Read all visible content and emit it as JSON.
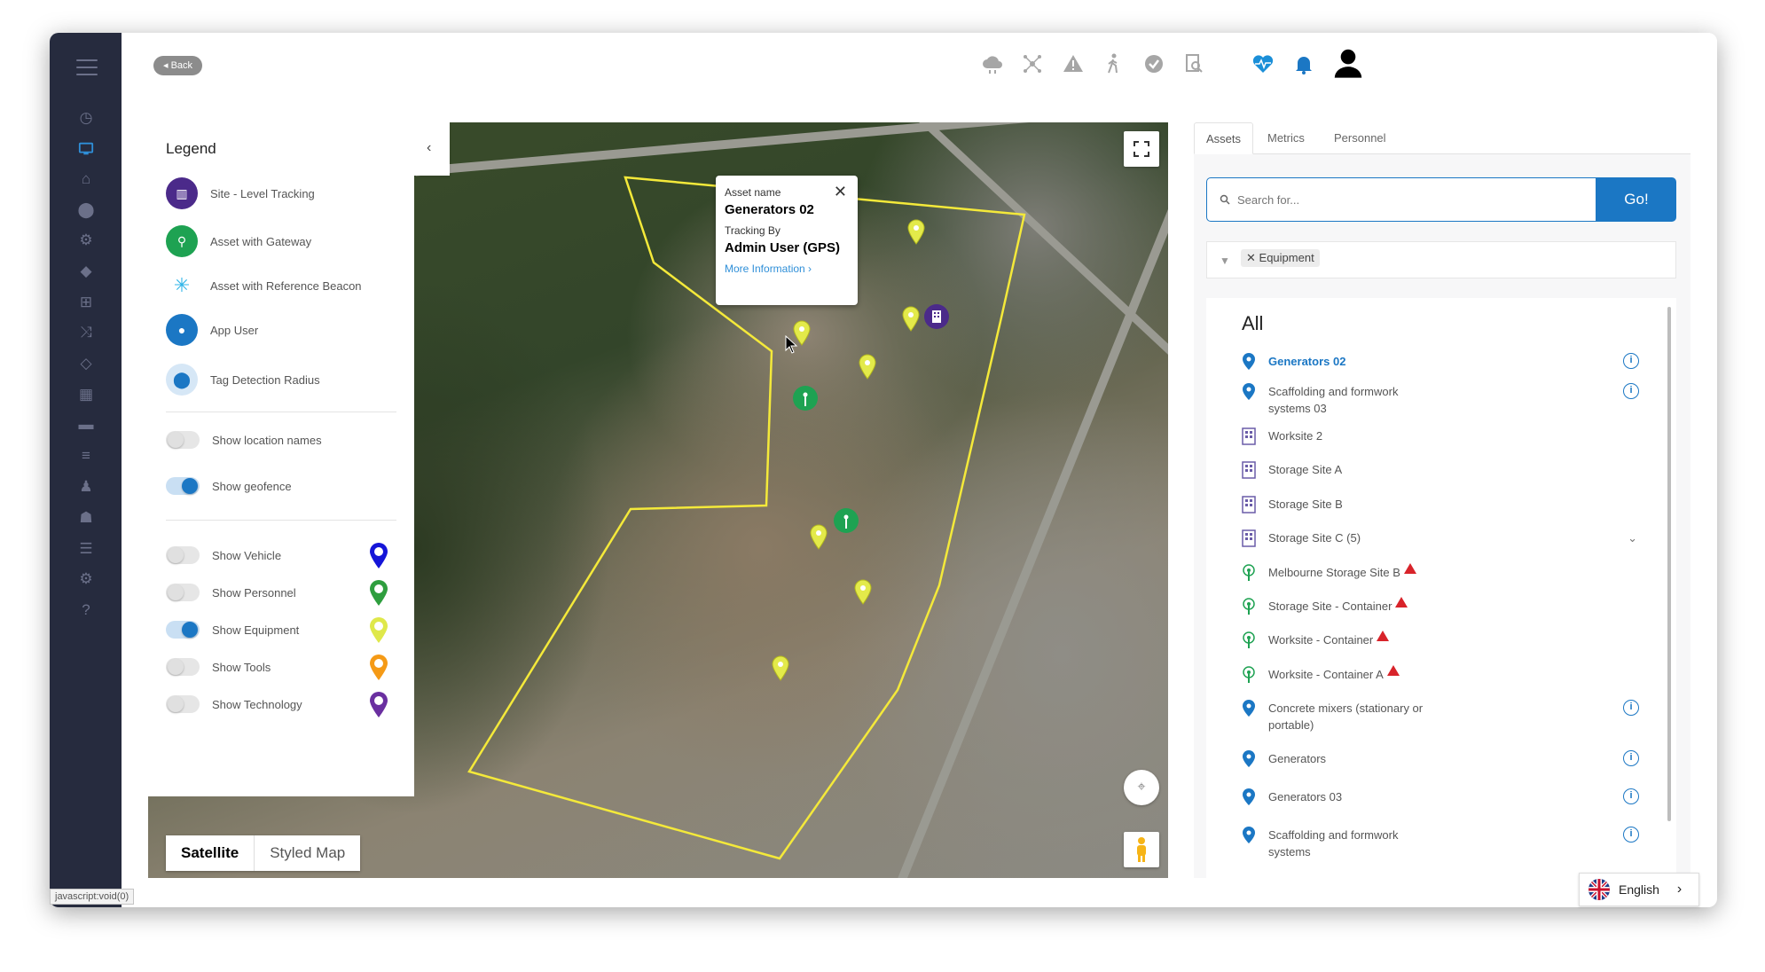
{
  "header": {
    "back_label": "Back",
    "icons": [
      "cloud-icon",
      "network-icon",
      "warning-icon",
      "walking-person-icon",
      "check-circle-icon",
      "search-document-icon",
      "heartbeat-icon",
      "bell-icon",
      "user-icon"
    ]
  },
  "sidebar": {
    "icons": [
      "menu-icon",
      "dashboard-icon",
      "monitor-icon",
      "home-icon",
      "location-pin-icon",
      "settings-sliders-icon",
      "tags-icon",
      "sitemap-icon",
      "shuffle-icon",
      "tag-icon",
      "calendar-icon",
      "briefcase-icon",
      "list-icon",
      "person-pin-icon",
      "users-icon",
      "report-icon",
      "gear-icon",
      "help-icon"
    ]
  },
  "legend": {
    "title": "Legend",
    "items": [
      {
        "label": "Site - Level Tracking",
        "icon": "building-icon",
        "color": "#4b2a8a"
      },
      {
        "label": "Asset with Gateway",
        "icon": "gateway-icon",
        "color": "#1ea252"
      },
      {
        "label": "Asset with Reference Beacon",
        "icon": "beacon-icon",
        "color": "#2fb5e8"
      },
      {
        "label": "App User",
        "icon": "pin-icon",
        "color": "#1b77c4"
      },
      {
        "label": "Tag Detection Radius",
        "icon": "radius-icon",
        "color": "#1b77c4"
      }
    ],
    "toggles": [
      {
        "label": "Show location names",
        "on": false
      },
      {
        "label": "Show geofence",
        "on": true
      }
    ],
    "layers": [
      {
        "label": "Show Vehicle",
        "on": false,
        "color": "#1515d8"
      },
      {
        "label": "Show Personnel",
        "on": false,
        "color": "#2e9e3e"
      },
      {
        "label": "Show Equipment",
        "on": true,
        "color": "#dfe84a"
      },
      {
        "label": "Show Tools",
        "on": false,
        "color": "#f59a16"
      },
      {
        "label": "Show Technology",
        "on": false,
        "color": "#6a2fa0"
      }
    ]
  },
  "map": {
    "type_selected": "Satellite",
    "type_other": "Styled Map",
    "popup": {
      "asset_label": "Asset name",
      "asset_value": "Generators 02",
      "tracking_label": "Tracking By",
      "tracking_value": "Admin User (GPS)",
      "more_label": "More Information",
      "more_chevron": "›",
      "close": "✕"
    }
  },
  "panel": {
    "tabs": [
      "Assets",
      "Metrics",
      "Personnel"
    ],
    "active_tab": "Assets",
    "search_placeholder": "Search for...",
    "go_label": "Go!",
    "filter_chip": "Equipment",
    "list_title": "All",
    "items": [
      {
        "label": "Generators 02",
        "type": "pin",
        "info": true,
        "highlighted": true
      },
      {
        "label": "Scaffolding and formwork systems 03",
        "type": "pin",
        "info": true
      },
      {
        "label": "Worksite 2",
        "type": "building"
      },
      {
        "label": "Storage Site A",
        "type": "building"
      },
      {
        "label": "Storage Site B",
        "type": "building"
      },
      {
        "label": "Storage Site C (5)",
        "type": "building",
        "expand": true
      },
      {
        "label": "Melbourne Storage Site B",
        "type": "gateway",
        "warn": true
      },
      {
        "label": "Storage Site - Container",
        "type": "gateway",
        "warn": true
      },
      {
        "label": "Worksite - Container",
        "type": "gateway",
        "warn": true
      },
      {
        "label": "Worksite - Container A",
        "type": "gateway",
        "warn": true
      },
      {
        "label": "Concrete mixers (stationary or portable)",
        "type": "pin",
        "info": true
      },
      {
        "label": "Generators",
        "type": "pin",
        "info": true
      },
      {
        "label": "Generators 03",
        "type": "pin",
        "info": true
      },
      {
        "label": "Scaffolding and formwork systems",
        "type": "pin",
        "info": true
      }
    ]
  },
  "status_bar": "javascript:void(0)",
  "language": "English"
}
